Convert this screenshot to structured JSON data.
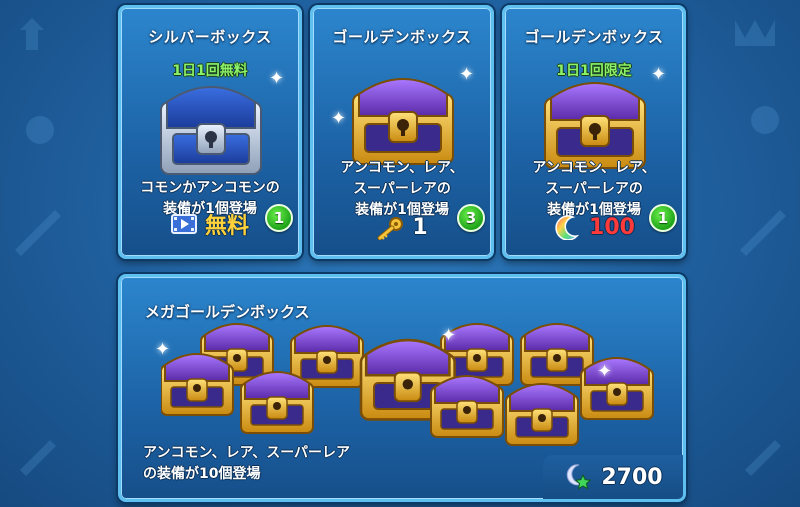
{
  "boxes": [
    {
      "title": "シルバーボックス",
      "limit": "1日1回無料",
      "desc_lines": [
        "コモンかアンコモンの",
        "装備が1個登場"
      ],
      "badge": "1",
      "price_icon": "video-icon",
      "price": "無料",
      "chest_type": "silver"
    },
    {
      "title": "ゴールデンボックス",
      "limit": "",
      "desc_lines": [
        "アンコモン、レア、",
        "スーパーレアの",
        "装備が1個登場"
      ],
      "badge": "3",
      "price_icon": "key-icon",
      "price": "1",
      "chest_type": "gold"
    },
    {
      "title": "ゴールデンボックス",
      "limit": "1日1回限定",
      "desc_lines": [
        "アンコモン、レア、",
        "スーパーレアの",
        "装備が1個登場"
      ],
      "badge": "1",
      "price_icon": "rainbow-crescent-icon",
      "price": "100",
      "chest_type": "gold"
    }
  ],
  "mega": {
    "title": "メガゴールデンボックス",
    "desc_lines": [
      "アンコモン、レア、スーパーレア",
      "の装備が10個登場"
    ],
    "price_icon": "moon-star-icon",
    "price": "2700"
  },
  "colors": {
    "panel_border": "#5fc0f0",
    "limit_green": "#8cf26a",
    "badge_green": "#1fa31a",
    "free_yellow": "#ffd23a",
    "price_red": "#ff3a3a",
    "chest_purple": "#7b3fd0",
    "chest_gold": "#f2b822"
  }
}
